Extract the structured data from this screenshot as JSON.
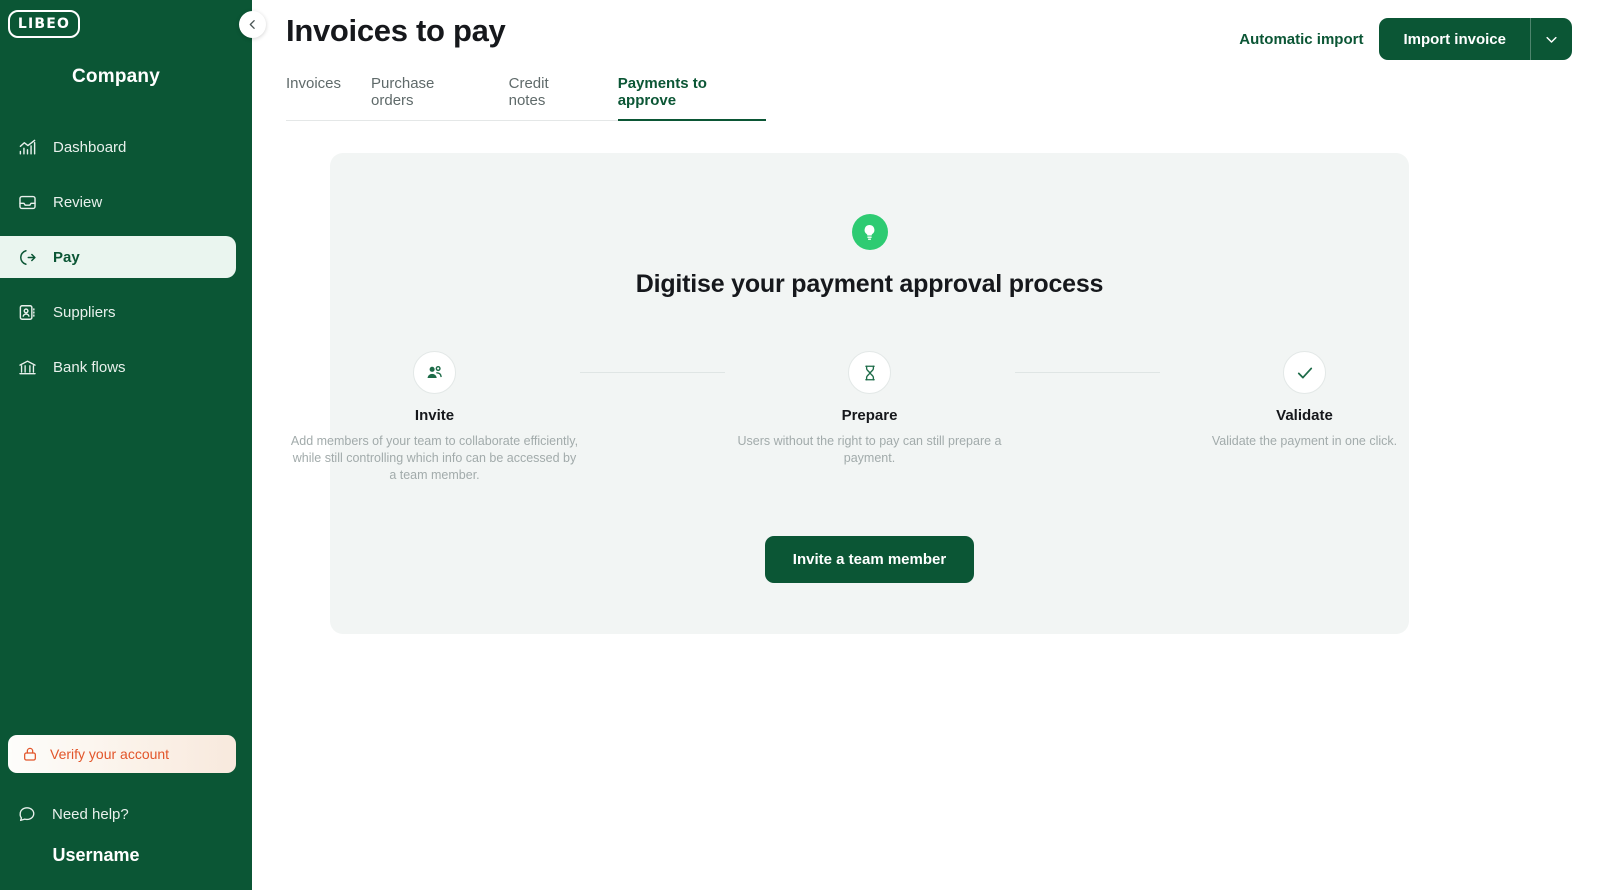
{
  "brand": {
    "logo_text": "LIBEO",
    "sidebar_color": "#0B5635",
    "accent_green": "#2ECB72",
    "verify_color": "#E2552A"
  },
  "sidebar": {
    "company": "Company",
    "items": [
      {
        "label": "Dashboard",
        "icon": "chart-bars-icon",
        "active": false
      },
      {
        "label": "Review",
        "icon": "inbox-icon",
        "active": false
      },
      {
        "label": "Pay",
        "icon": "arrow-exit-icon",
        "active": true
      },
      {
        "label": "Suppliers",
        "icon": "contact-card-icon",
        "active": false
      },
      {
        "label": "Bank flows",
        "icon": "bank-icon",
        "active": false
      }
    ],
    "verify_account": "Verify your account",
    "need_help": "Need help?",
    "username": "Username",
    "collapse_icon": "chevron-left-icon"
  },
  "header": {
    "title": "Invoices to pay",
    "automatic_import": "Automatic import",
    "import_invoice": "Import invoice",
    "import_caret_icon": "chevron-down-icon"
  },
  "tabs": [
    {
      "label": "Invoices",
      "active": false
    },
    {
      "label": "Purchase orders",
      "active": false
    },
    {
      "label": "Credit notes",
      "active": false
    },
    {
      "label": "Payments to approve",
      "active": true
    }
  ],
  "card": {
    "badge_icon": "lightbulb-icon",
    "title": "Digitise your payment approval process",
    "steps": [
      {
        "icon": "people-group-icon",
        "label": "Invite",
        "desc": "Add members of your team to collaborate efficiently, while still controlling which info can be accessed by a team member."
      },
      {
        "icon": "hourglass-icon",
        "label": "Prepare",
        "desc": "Users without the right to pay can still prepare a payment."
      },
      {
        "icon": "check-icon",
        "label": "Validate",
        "desc": "Validate the payment in one click."
      }
    ],
    "cta": "Invite a team member"
  }
}
